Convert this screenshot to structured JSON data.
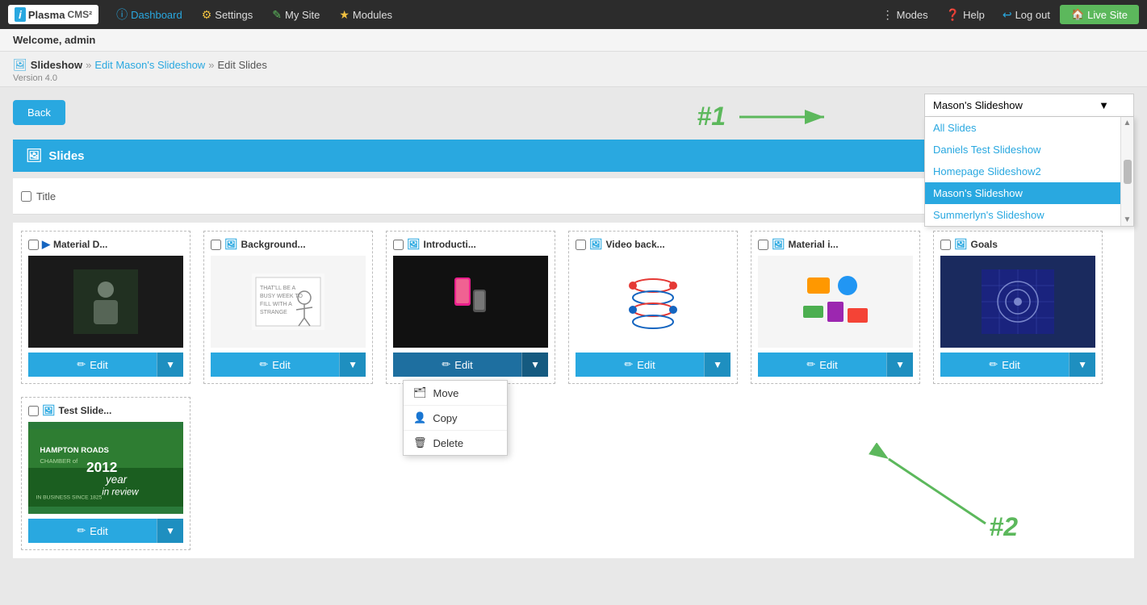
{
  "brand": {
    "i": "i",
    "name": "Plasma",
    "cms": "CMS²"
  },
  "topnav": {
    "dashboard": "Dashboard",
    "settings": "Settings",
    "mysite": "My Site",
    "modules": "Modules",
    "modes": "Modes",
    "help": "Help",
    "logout": "Log out",
    "livesite": "Live Site"
  },
  "welcome": "Welcome, admin",
  "breadcrumb": {
    "root": "Slideshow",
    "step1": "Edit Mason's Slideshow",
    "step2": "Edit Slides"
  },
  "version": "Version 4.0",
  "backBtn": "Back",
  "slidesHeader": "Slides",
  "columnHeader": "Title",
  "dropdown": {
    "selected": "Mason's Slideshow",
    "items": [
      {
        "label": "All Slides",
        "selected": false
      },
      {
        "label": "Daniels Test Slideshow",
        "selected": false
      },
      {
        "label": "Homepage Slideshow2",
        "selected": false
      },
      {
        "label": "Mason's Slideshow",
        "selected": true
      },
      {
        "label": "Summerlyn's Slideshow",
        "selected": false
      }
    ]
  },
  "annotation1": "#1",
  "annotation2": "#2",
  "slides": [
    {
      "id": 1,
      "title": "Material D...",
      "type": "video",
      "thumbType": "material-d"
    },
    {
      "id": 2,
      "title": "Background...",
      "type": "image",
      "thumbType": "background"
    },
    {
      "id": 3,
      "title": "Introducti...",
      "type": "image",
      "thumbType": "introducti",
      "contextOpen": true
    },
    {
      "id": 4,
      "title": "Video back...",
      "type": "image",
      "thumbType": "video-back"
    },
    {
      "id": 5,
      "title": "Material i...",
      "type": "image",
      "thumbType": "material-i"
    },
    {
      "id": 6,
      "title": "Goals",
      "type": "image",
      "thumbType": "goals"
    },
    {
      "id": 7,
      "title": "Test Slide...",
      "type": "image",
      "thumbType": "test-slide"
    }
  ],
  "editBtn": "Edit",
  "contextMenu": {
    "items": [
      {
        "label": "Move",
        "icon": "📁"
      },
      {
        "label": "Copy",
        "icon": "👤"
      },
      {
        "label": "Delete",
        "icon": "🗑"
      }
    ]
  }
}
